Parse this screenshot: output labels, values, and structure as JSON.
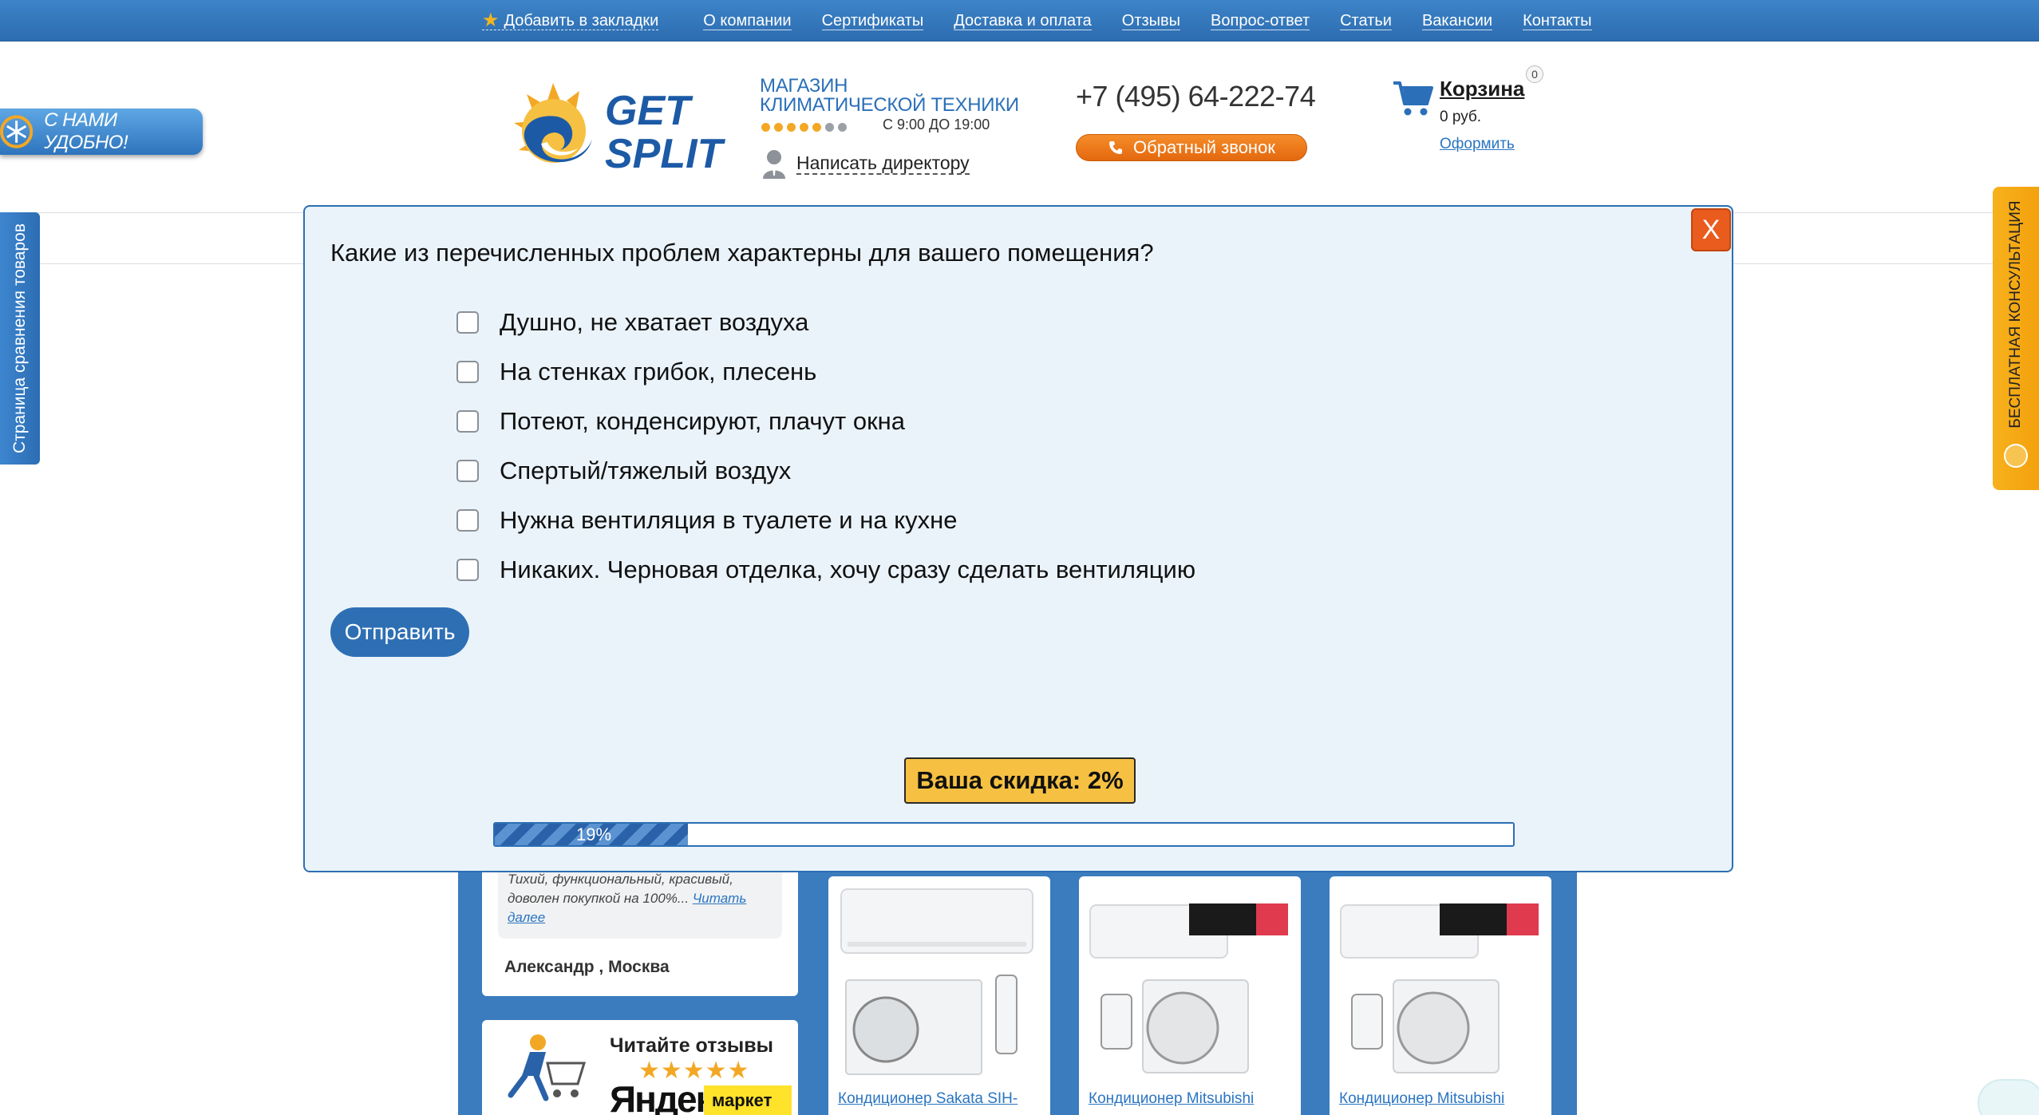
{
  "topnav": {
    "bookmark": "Добавить в закладки",
    "items": [
      "О компании",
      "Сертификаты",
      "Доставка и оплата",
      "Отзывы",
      "Вопрос-ответ",
      "Статьи",
      "Вакансии",
      "Контакты"
    ]
  },
  "header": {
    "logo_line1": "GET",
    "logo_line2": "SPLIT",
    "shop_line1": "МАГАЗИН",
    "shop_line2": "КЛИМАТИЧЕСКОЙ ТЕХНИКИ",
    "hours": "С 9:00 ДО 19:00",
    "director": "Написать директору",
    "phone": "+7 (495) 64-222-74",
    "callback": "Обратный звонок",
    "cart_title": "Корзина",
    "cart_count": "0",
    "cart_sum": "0 руб.",
    "cart_order": "Оформить"
  },
  "side": {
    "convenient": "С НАМИ УДОБНО!",
    "compare": "Страница сравнения товаров",
    "consult": "БЕСПЛАТНАЯ КОНСУЛЬТАЦИЯ"
  },
  "quiz": {
    "close": "X",
    "question": "Какие из перечисленных проблем характерны для вашего помещения?",
    "options": [
      "Душно, не хватает воздуха",
      "На стенках грибок, плесень",
      "Потеют, конденсируют, плачут окна",
      "Спертый/тяжелый воздух",
      "Нужна вентиляция в туалете и на кухне",
      "Никаких. Черновая отделка, хочу сразу сделать вентиляцию"
    ],
    "submit": "Отправить",
    "discount": "Ваша скидка: 2%",
    "progress_label": "19%",
    "progress": 0.19
  },
  "review": {
    "text": "Тихий, функциональный, красивый, доволен покупкой на 100%...",
    "more": "Читать далее",
    "author": "Александр , Москва"
  },
  "yandex": {
    "title": "Читайте отзывы",
    "brand": "Яндекс",
    "market": "маркет"
  },
  "products": [
    {
      "name": "Кондиционер Sakata SIH-"
    },
    {
      "name": "Кондиционер Mitsubishi"
    },
    {
      "name": "Кондиционер Mitsubishi"
    }
  ],
  "colors": {
    "primary": "#2e6fb4",
    "accent": "#e95c1e",
    "discount": "#f6c142"
  }
}
